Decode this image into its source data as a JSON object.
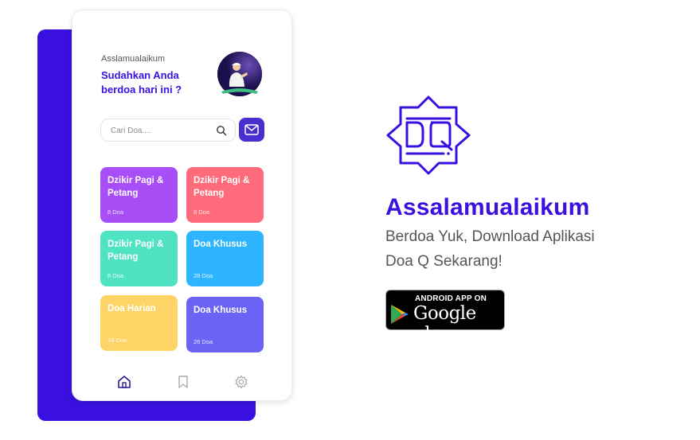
{
  "app": {
    "greeting": "Asslamualaikum",
    "question": "Sudahkan Anda berdoa hari ini ?",
    "search_placeholder": "Cari Doa....",
    "cards": [
      {
        "title": "Dzikir Pagi & Petang",
        "count": "8 Doa",
        "color": "#a74ef7"
      },
      {
        "title": "Dzikir Pagi & Petang",
        "count": "8 Doa",
        "color": "#ff6b7a"
      },
      {
        "title": "Dzikir Pagi & Petang",
        "count": "8 Doa",
        "color": "#4fe3c3"
      },
      {
        "title": "Doa Khusus",
        "count": "28 Doa",
        "color": "#2db5ff"
      },
      {
        "title": "Doa Harian",
        "count": "24 Doa",
        "color": "#ffd466"
      },
      {
        "title": "Doa Khusus",
        "count": "26 Doa",
        "color": "#6a63f5"
      }
    ],
    "nav": [
      "home-icon",
      "bookmark-icon",
      "gear-icon"
    ]
  },
  "promo": {
    "headline": "Assalamualaikum",
    "subline_1": "Berdoa Yuk, Download Aplikasi",
    "subline_2": "Doa Q Sekarang!",
    "badge_small": "ANDROID APP ON",
    "badge_big": "Google play"
  },
  "colors": {
    "accent": "#3a10e0"
  }
}
